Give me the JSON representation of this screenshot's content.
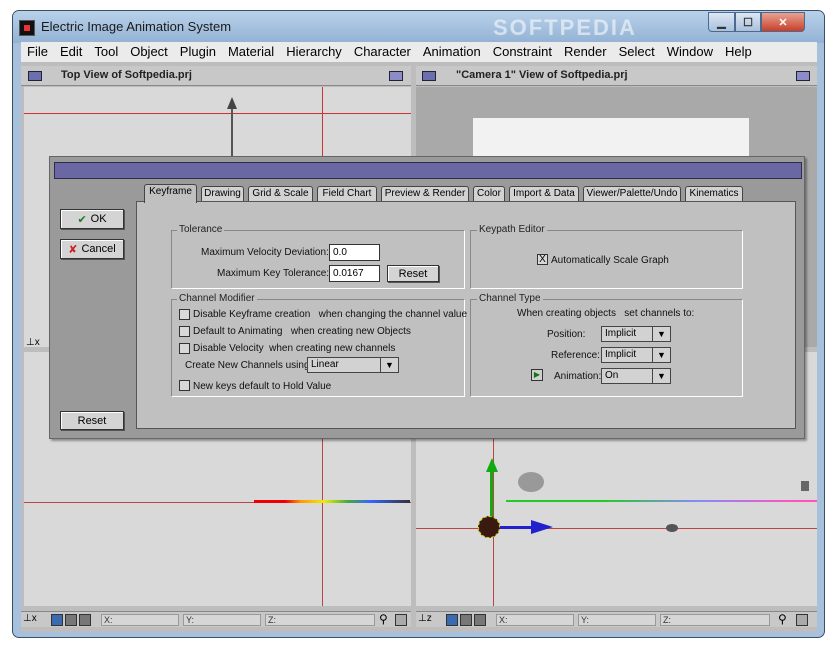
{
  "window": {
    "title": "Electric Image Animation System",
    "watermark": "SOFTPEDIA"
  },
  "menu": [
    "File",
    "Edit",
    "Tool",
    "Object",
    "Plugin",
    "Material",
    "Hierarchy",
    "Character",
    "Animation",
    "Constraint",
    "Render",
    "Select",
    "Window",
    "Help"
  ],
  "viewports": {
    "top_left_title": "Top View of Softpedia.prj",
    "top_right_title": "\"Camera 1\" View of Softpedia.prj"
  },
  "statusbar": {
    "x": "X:",
    "y": "Y:",
    "z": "Z:"
  },
  "dialog": {
    "tabs": [
      "Keyframe",
      "Drawing",
      "Grid & Scale",
      "Field Chart",
      "Preview & Render",
      "Color",
      "Import & Data",
      "Viewer/Palette/Undo",
      "Kinematics"
    ],
    "active_tab": "Keyframe",
    "ok_label": "OK",
    "cancel_label": "Cancel",
    "reset_label": "Reset",
    "tolerance": {
      "title": "Tolerance",
      "max_velocity_label": "Maximum Velocity Deviation:",
      "max_velocity_value": "0.0",
      "max_key_label": "Maximum Key Tolerance:",
      "max_key_value": "0.0167",
      "reset_label": "Reset"
    },
    "keypath": {
      "title": "Keypath Editor",
      "auto_scale_label": "Automatically Scale Graph",
      "auto_scale_checked": "X"
    },
    "channel_modifier": {
      "title": "Channel Modifier",
      "opt1": "Disable Keyframe creation   when changing the channel value",
      "opt2": "Default to Animating   when creating new Objects",
      "opt3": "Disable Velocity  when creating new channels",
      "create_label": "Create New Channels using:",
      "create_value": "Linear",
      "opt4": "New keys default to Hold Value"
    },
    "channel_type": {
      "title": "Channel Type",
      "intro": "When creating objects   set channels to:",
      "position_label": "Position:",
      "position_value": "Implicit",
      "reference_label": "Reference:",
      "reference_value": "Implicit",
      "animation_label": "Animation:",
      "animation_value": "On"
    }
  },
  "colors": {
    "dialog_title_bar": "#6b67a3",
    "viewport_bg": "#d9d9d9",
    "titlebar": "#a7c1dc"
  }
}
